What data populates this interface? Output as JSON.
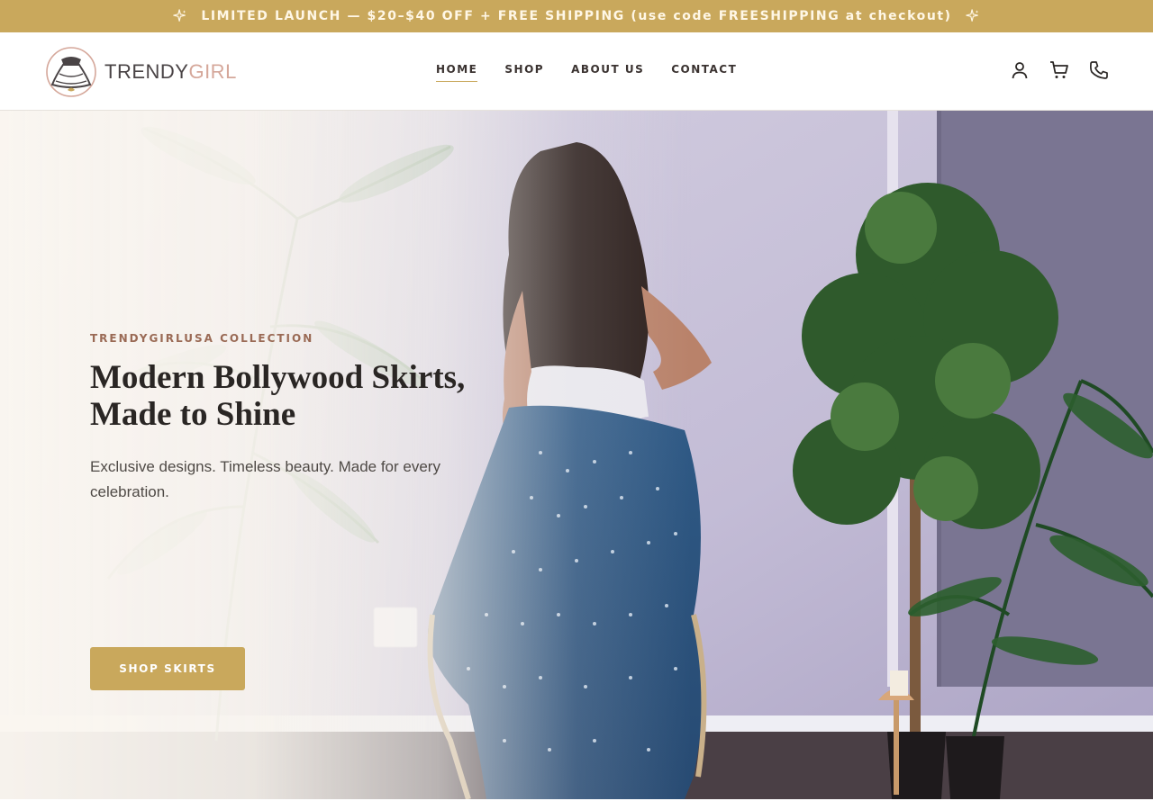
{
  "announcement": {
    "text": "LIMITED LAUNCH — $20–$40 OFF + FREE SHIPPING (use code FREESHIPPING at checkout)",
    "icon_left": "sparkle-icon",
    "icon_right": "sparkle-icon"
  },
  "header": {
    "logo": {
      "text_dark": "TRENDY",
      "text_accent": "GIRL"
    },
    "nav": [
      {
        "label": "HOME",
        "active": true
      },
      {
        "label": "SHOP",
        "active": false
      },
      {
        "label": "ABOUT US",
        "active": false
      },
      {
        "label": "CONTACT",
        "active": false
      }
    ],
    "icons": [
      "account-icon",
      "cart-icon",
      "phone-icon"
    ]
  },
  "hero": {
    "eyebrow": "TRENDYGIRLUSA COLLECTION",
    "headline_line1": "Modern Bollywood Skirts,",
    "headline_line2": "Made to Shine",
    "subtext": "Exclusive designs. Timeless beauty. Made for every celebration.",
    "cta_label": "SHOP SKIRTS"
  },
  "colors": {
    "accent_gold": "#c9a85c",
    "eyebrow_brown": "#9a6a55",
    "heading_dark": "#2a2624",
    "logo_pink": "#d5a79a"
  }
}
